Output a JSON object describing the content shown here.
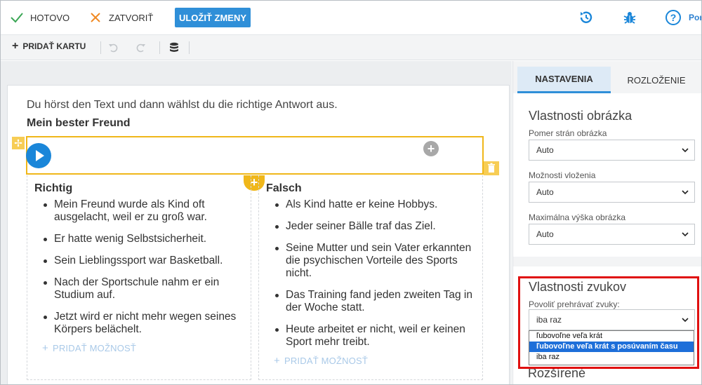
{
  "topbar": {
    "done_label": "HOTOVO",
    "close_label": "ZATVORIŤ",
    "save_label": "ULOŽIŤ ZMENY",
    "help_label": "Por"
  },
  "toolbar2": {
    "add_card_label": "PRIDAŤ KARTU"
  },
  "canvas": {
    "instruction": "Du hörst den Text und dann wählst du die richtige Antwort aus.",
    "subtitle": "Mein bester Freund",
    "columns": [
      {
        "title": "Richtig",
        "items": [
          "Mein Freund wurde als Kind oft ausgelacht, weil er zu groß war.",
          "Er hatte wenig Selbstsicherheit.",
          "Sein Lieblingssport war Basketball.",
          "Nach der Sportschule nahm er ein Studium auf.",
          "Jetzt wird er nicht mehr wegen seines Körpers belächelt."
        ],
        "add_option_label": "PRIDAŤ MOŽNOSŤ"
      },
      {
        "title": "Falsch",
        "items": [
          "Als Kind hatte er keine Hobbys.",
          "Jeder seiner Bälle traf das Ziel.",
          "Seine Mutter und sein Vater erkannten die psychischen Vorteile des Sports nicht.",
          "Das Training fand jeden zweiten Tag in der Woche statt.",
          "Heute arbeitet er nicht, weil er keinen Sport mehr treibt."
        ],
        "add_option_label": "PRIDAŤ MOŽNOSŤ"
      }
    ]
  },
  "panel": {
    "tabs": [
      "NASTAVENIA",
      "ROZLOŽENIE"
    ],
    "active_tab": "NASTAVENIA",
    "image_section": {
      "title": "Vlastnosti obrázka",
      "fields": [
        {
          "label": "Pomer strán obrázka",
          "value": "Auto"
        },
        {
          "label": "Možnosti vloženia",
          "value": "Auto"
        },
        {
          "label": "Maximálna výška obrázka",
          "value": "Auto"
        }
      ]
    },
    "sound_section": {
      "title": "Vlastnosti zvukov",
      "field_label": "Povoliť prehrávať zvuky:",
      "value": "iba raz",
      "options": [
        "ľubovoľne veľa krát",
        "ľubovoľne veľa krát s posúvaním času",
        "iba raz"
      ],
      "highlighted_option": "ľubovoľne veľa krát s posúvaním času"
    },
    "advanced_title": "Rozšírené"
  },
  "colors": {
    "accent_blue": "#2f8fd8",
    "highlight_yellow": "#f0b71a",
    "annotation_red": "#e01010"
  }
}
